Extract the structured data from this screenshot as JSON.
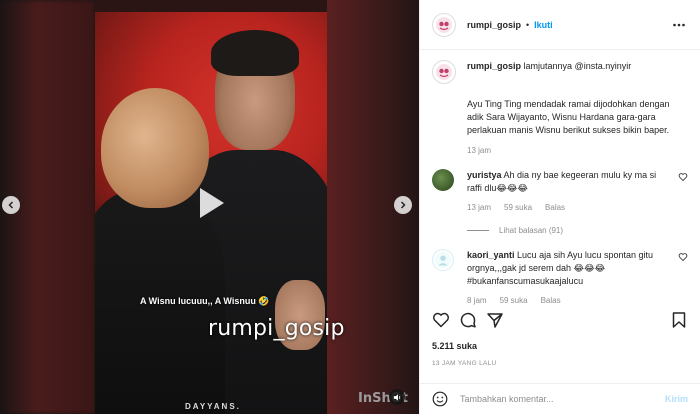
{
  "media": {
    "caption_overlay": "A Wisnu lucuuu,, A Wisnuu 🤣",
    "watermark": "rumpi_gosip",
    "brand_tag": "DAYYANS.",
    "inshot_mark": "InShOt"
  },
  "header": {
    "username": "rumpi_gosip",
    "separator": "•",
    "follow_label": "Ikuti"
  },
  "post_caption": {
    "username": "rumpi_gosip",
    "first_line": "lamjutannya @insta.nyinyir",
    "text": "Ayu Ting Ting mendadak ramai dijodohkan dengan adik Sara Wijayanto, Wisnu Hardana gara-gara perlakuan manis Wisnu berikut sukses bikin baper.",
    "time": "13 jam"
  },
  "comments": [
    {
      "username": "yuristya",
      "text": "Ah dia ny bae kegeeran mulu ky ma si raffi dlu😂😂😂",
      "time": "13 jam",
      "likes": "59 suka",
      "reply_label": "Balas",
      "view_replies": "Lihat balasan (91)"
    },
    {
      "username": "kaori_yanti",
      "text": "Lucu aja sih Ayu lucu spontan gitu orgnya,,,gak jd serem dah 😂😂😂 #bukanfanscumasukaajalucu",
      "time": "8 jam",
      "likes": "59 suka",
      "reply_label": "Balas"
    }
  ],
  "likes": "5.211 suka",
  "post_time": "13 JAM YANG LALU",
  "add_comment": {
    "placeholder": "Tambahkan komentar...",
    "post_label": "Kirim"
  },
  "colors": {
    "accent": "#0095f6",
    "muted": "#8e8e8e",
    "post_disabled": "#b2dffc"
  }
}
